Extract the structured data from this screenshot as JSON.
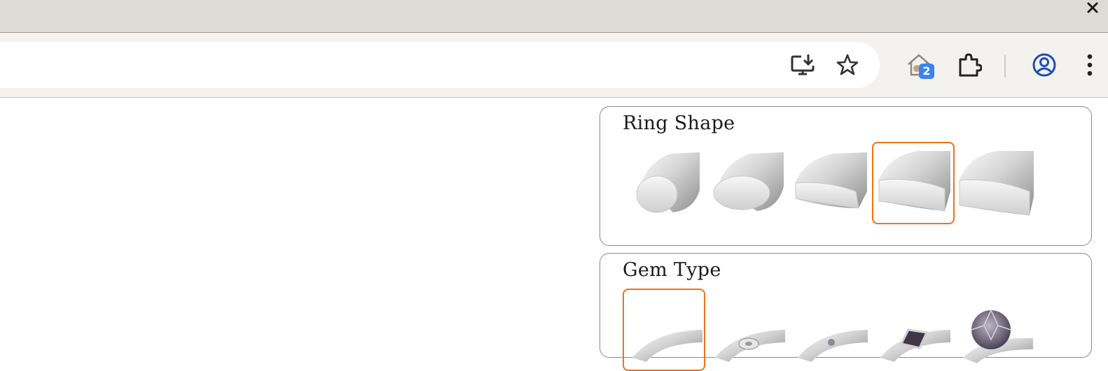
{
  "toolbar": {
    "badge_count": "2"
  },
  "icons": {
    "close": "close-icon",
    "install": "install-app-icon",
    "bookmark": "bookmark-star-icon",
    "home_extension": "home-extension-icon",
    "extensions": "puzzle-piece-icon",
    "profile": "profile-avatar-icon",
    "menu": "kebab-menu-icon"
  },
  "ring_shape": {
    "title": "Ring Shape",
    "options": [
      "shape-1",
      "shape-2",
      "shape-3",
      "shape-4",
      "shape-5"
    ],
    "selected_index": 3
  },
  "gem_type": {
    "title": "Gem Type",
    "options": [
      "no-gem",
      "bezel-set",
      "small-stone",
      "emerald-cut",
      "round-solitaire"
    ],
    "selected_index": 0
  },
  "colors": {
    "accent": "#f07020",
    "badge": "#3b82f6",
    "titlebar": "#dedbd6",
    "toolbar": "#f4f2ef"
  }
}
